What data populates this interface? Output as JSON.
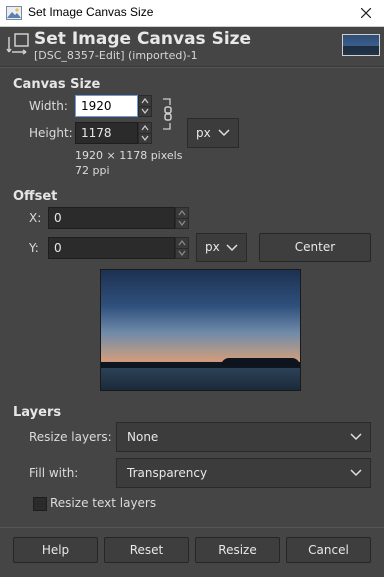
{
  "window": {
    "title": "Set Image Canvas Size",
    "close_glyph": "✕"
  },
  "header": {
    "title": "Set Image Canvas Size",
    "subtitle": "[DSC_8357-Edit] (imported)-1",
    "icon": "canvas-size-icon"
  },
  "canvas_size": {
    "section_label": "Canvas Size",
    "width_label": "Width:",
    "width_value": "1920",
    "height_label": "Height:",
    "height_value": "1178",
    "unit": "px",
    "size_info": "1920 × 1178 pixels",
    "resolution_info": "72 ppi",
    "chain_icon": "chain-link-icon"
  },
  "offset": {
    "section_label": "Offset",
    "x_label": "X:",
    "x_value": "0",
    "y_label": "Y:",
    "y_value": "0",
    "unit": "px",
    "center_label": "Center"
  },
  "layers": {
    "section_label": "Layers",
    "resize_layers_label": "Resize layers:",
    "resize_layers_value": "None",
    "fill_with_label": "Fill with:",
    "fill_with_value": "Transparency",
    "resize_text_layers_label": "Resize text layers",
    "resize_text_layers_checked": false
  },
  "buttons": {
    "help": "Help",
    "reset": "Reset",
    "resize": "Resize",
    "cancel": "Cancel"
  }
}
